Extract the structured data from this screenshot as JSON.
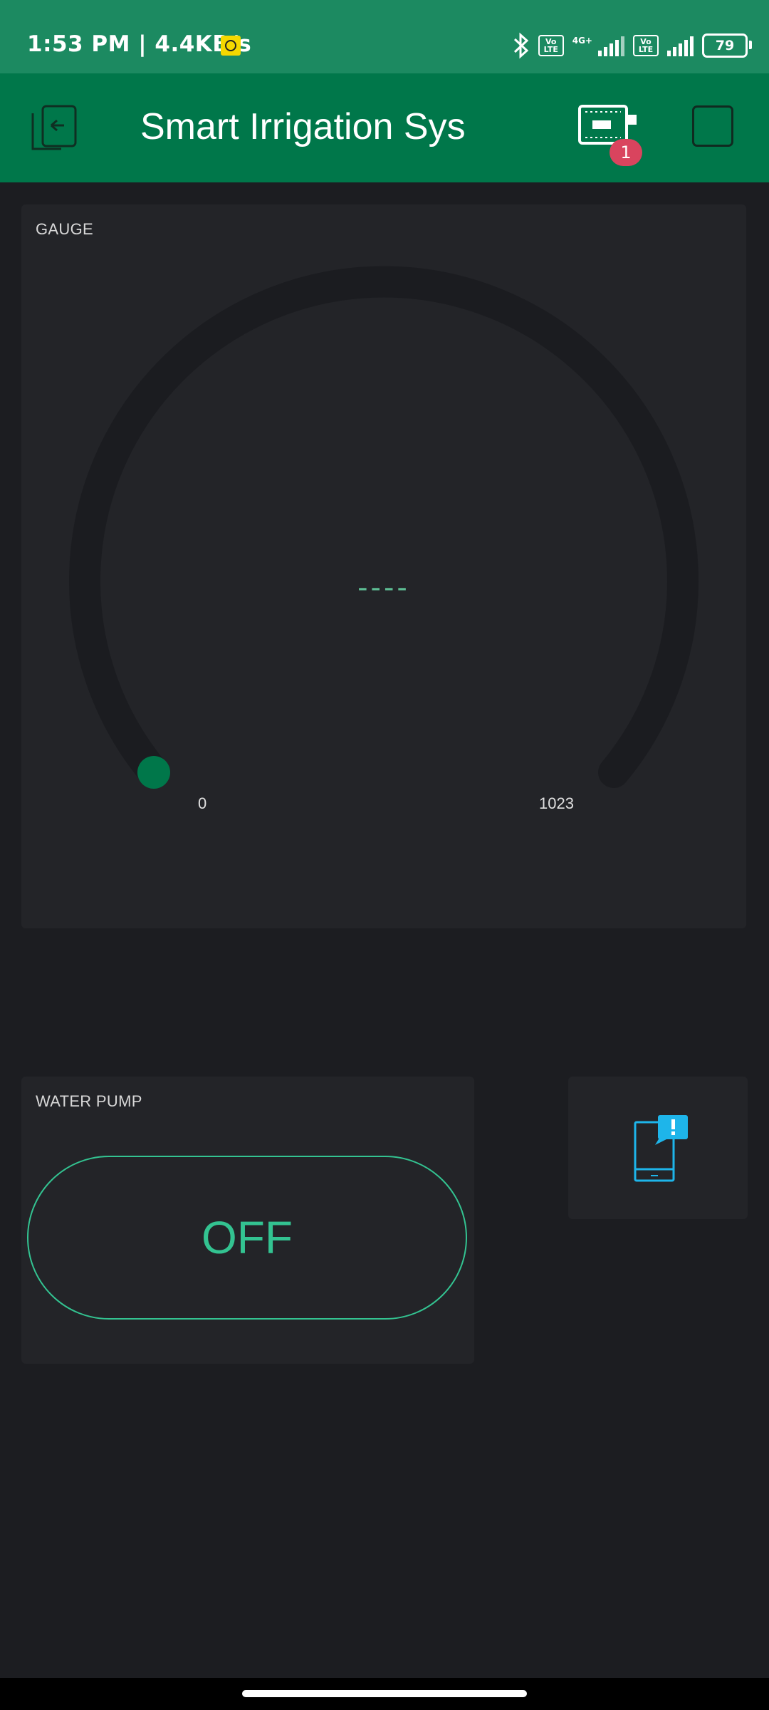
{
  "status_bar": {
    "time": "1:53 PM | 4.4KB/s",
    "volte_1": "Vo LTE",
    "network_type": "4G+",
    "volte_2": "Vo LTE",
    "battery": "79"
  },
  "app_bar": {
    "title": "Smart Irrigation Sys",
    "device_badge_count": "1"
  },
  "gauge": {
    "label": "GAUGE",
    "value": "----",
    "min": "0",
    "max": "1023",
    "fill_fraction": 0
  },
  "water_pump": {
    "label": "WATER PUMP",
    "state": "OFF"
  },
  "colors": {
    "status_bar": "#1c8a61",
    "app_bar": "#00774a",
    "background": "#1c1d21",
    "panel": "#232428",
    "accent_green": "#33c391",
    "gauge_dot": "#00774a",
    "badge_red": "#d9445e",
    "notify_blue": "#1eb5ea"
  },
  "icons": {
    "back": "back-icon",
    "device": "device-icon",
    "stop": "stop-icon",
    "notify": "notification-icon",
    "bluetooth": "bluetooth-icon"
  }
}
